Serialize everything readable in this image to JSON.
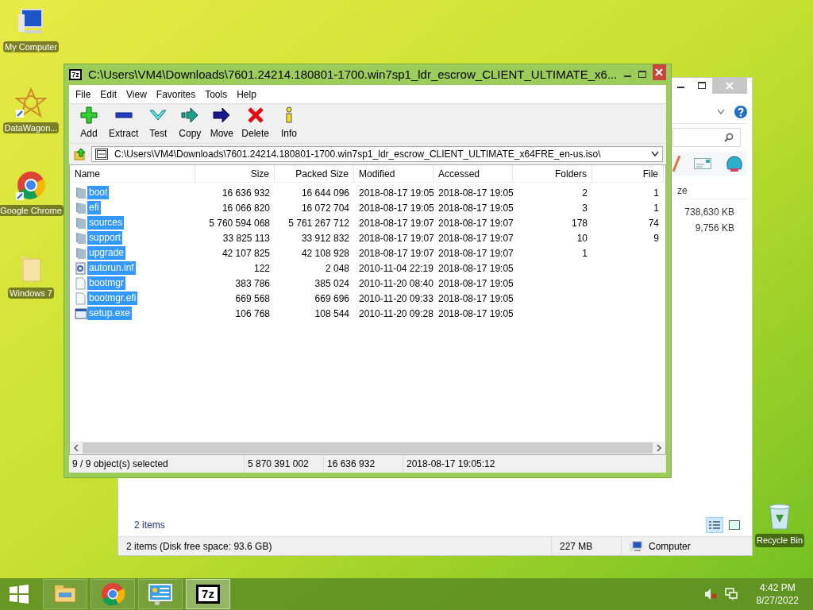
{
  "desktop_icons": [
    {
      "kind": "computer",
      "label": "My Computer"
    },
    {
      "kind": "datawagon",
      "label": "DataWagon..."
    },
    {
      "kind": "chrome",
      "label": "Google Chrome"
    },
    {
      "kind": "folder",
      "label": "Windows 7"
    }
  ],
  "recycle_bin": {
    "label": "Recycle Bin"
  },
  "explorer_window": {
    "column_header": "ze",
    "values": [
      "738,630 KB",
      "9,756 KB"
    ],
    "item_count": "2 items",
    "status_bar": {
      "summary": "2 items (Disk free space: 93.6 GB)",
      "size": "227 MB",
      "location": "Computer"
    }
  },
  "archive_window": {
    "logo": "7z",
    "title": "C:\\Users\\VM4\\Downloads\\7601.24214.180801-1700.win7sp1_ldr_escrow_CLIENT_ULTIMATE_x6...",
    "menu": [
      "File",
      "Edit",
      "View",
      "Favorites",
      "Tools",
      "Help"
    ],
    "toolbar": [
      {
        "kind": "add",
        "label": "Add"
      },
      {
        "kind": "extract",
        "label": "Extract"
      },
      {
        "kind": "test",
        "label": "Test"
      },
      {
        "kind": "copy",
        "label": "Copy"
      },
      {
        "kind": "move",
        "label": "Move"
      },
      {
        "kind": "delete",
        "label": "Delete"
      },
      {
        "kind": "info",
        "label": "Info"
      }
    ],
    "address": "C:\\Users\\VM4\\Downloads\\7601.24214.180801-1700.win7sp1_ldr_escrow_CLIENT_ULTIMATE_x64FRE_en-us.iso\\",
    "columns": [
      "Name",
      "Size",
      "Packed Size",
      "Modified",
      "Accessed",
      "Folders",
      "File"
    ],
    "rows": [
      {
        "kind": "folder",
        "selected": true,
        "cells": [
          "boot",
          "16 636 932",
          "16 644 096",
          "2018-08-17 19:05",
          "2018-08-17 19:05",
          "2",
          "1"
        ]
      },
      {
        "kind": "folder",
        "selected": true,
        "cells": [
          "efi",
          "16 066 820",
          "16 072 704",
          "2018-08-17 19:05",
          "2018-08-17 19:05",
          "3",
          "1"
        ]
      },
      {
        "kind": "folder",
        "selected": true,
        "cells": [
          "sources",
          "5 760 594 068",
          "5 761 267 712",
          "2018-08-17 19:07",
          "2018-08-17 19:07",
          "178",
          "74"
        ]
      },
      {
        "kind": "folder",
        "selected": true,
        "cells": [
          "support",
          "33 825 113",
          "33 912 832",
          "2018-08-17 19:07",
          "2018-08-17 19:07",
          "10",
          "9"
        ]
      },
      {
        "kind": "folder",
        "selected": true,
        "cells": [
          "upgrade",
          "42 107 825",
          "42 108 928",
          "2018-08-17 19:07",
          "2018-08-17 19:07",
          "1",
          ""
        ]
      },
      {
        "kind": "settings",
        "selected": true,
        "cells": [
          "autorun.inf",
          "122",
          "2 048",
          "2010-11-04 22:19",
          "2018-08-17 19:05",
          "",
          ""
        ]
      },
      {
        "kind": "file",
        "selected": true,
        "cells": [
          "bootmgr",
          "383 786",
          "385 024",
          "2010-11-20 08:40",
          "2018-08-17 19:05",
          "",
          ""
        ]
      },
      {
        "kind": "file",
        "selected": true,
        "cells": [
          "bootmgr.efi",
          "669 568",
          "669 696",
          "2010-11-20 09:33",
          "2018-08-17 19:05",
          "",
          ""
        ]
      },
      {
        "kind": "program",
        "selected": true,
        "cells": [
          "setup.exe",
          "106 768",
          "108 544",
          "2010-11-20 09:28",
          "2018-08-17 19:05",
          "",
          ""
        ]
      }
    ],
    "status_bar": [
      "9 / 9 object(s) selected",
      "5 870 391 002",
      "16 636 932",
      "2018-08-17 19:05:12"
    ]
  },
  "taskbar": {
    "items": [
      {
        "kind": "explorer",
        "selected": false
      },
      {
        "kind": "chrome",
        "selected": false
      },
      {
        "kind": "control",
        "selected": false
      },
      {
        "kind": "sevenzip",
        "selected": true
      }
    ],
    "sevenzip_logo": "7z",
    "time": "4:42 PM",
    "date": "8/27/2022"
  }
}
